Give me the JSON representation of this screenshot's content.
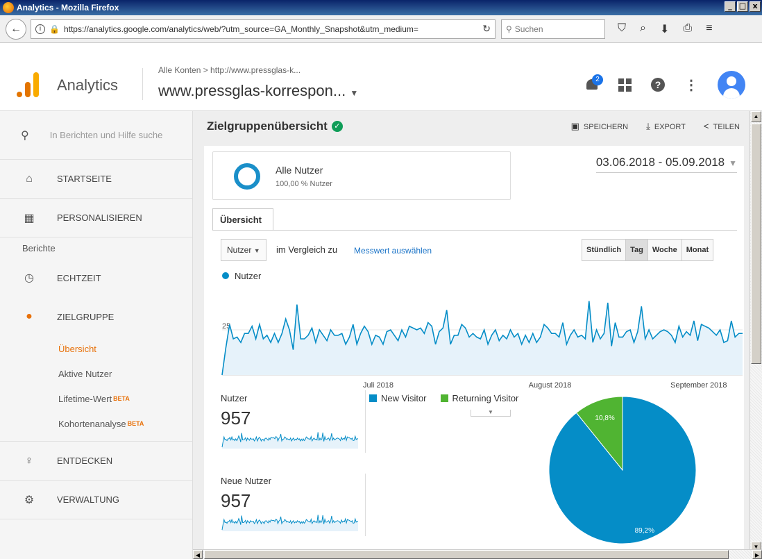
{
  "window": {
    "title": "Analytics - Mozilla Firefox",
    "buttons": [
      "_",
      "□",
      "x"
    ]
  },
  "browser": {
    "url": "https://analytics.google.com/analytics/web/?utm_source=GA_Monthly_Snapshot&utm_medium=",
    "search_placeholder": "Suchen"
  },
  "header": {
    "app_name": "Analytics",
    "breadcrumb": "Alle Konten > http://www.pressglas-k...",
    "property": "www.pressglas-korrespon...",
    "notification_count": "2",
    "accent_color": "#e37400"
  },
  "sidebar": {
    "search_placeholder": "In Berichten und Hilfe suche",
    "home": "STARTSEITE",
    "customize": "PERSONALISIEREN",
    "reports_heading": "Berichte",
    "realtime": "ECHTZEIT",
    "audience": "ZIELGRUPPE",
    "audience_sub": [
      {
        "label": "Übersicht",
        "beta": ""
      },
      {
        "label": "Aktive Nutzer",
        "beta": ""
      },
      {
        "label": "Lifetime-Wert",
        "beta": "BETA"
      },
      {
        "label": "Kohortenanalyse",
        "beta": "BETA"
      }
    ],
    "discover": "ENTDECKEN",
    "admin": "VERWALTUNG"
  },
  "main": {
    "title": "Zielgruppenübersicht",
    "actions": {
      "save": "SPEICHERN",
      "export": "EXPORT",
      "share": "TEILEN"
    },
    "segment": {
      "name": "Alle Nutzer",
      "pct": "100,00 % Nutzer"
    },
    "date_range": "03.06.2018 - 05.09.2018",
    "tab": "Übersicht",
    "metric_select": "Nutzer",
    "compare_text": "im Vergleich zu",
    "compare_link": "Messwert auswählen",
    "periods": [
      "Stündlich",
      "Tag",
      "Woche",
      "Monat"
    ],
    "active_period": "Tag",
    "series_label": "Nutzer"
  },
  "chart_data": [
    {
      "type": "area",
      "series": [
        {
          "name": "Nutzer",
          "values": [
            0,
            15,
            28,
            20,
            21,
            18,
            23,
            23,
            27,
            20,
            28,
            20,
            22,
            18,
            23,
            18,
            23,
            31,
            25,
            14,
            39,
            20,
            20,
            22,
            26,
            18,
            25,
            22,
            19,
            25,
            22,
            22,
            23,
            17,
            21,
            28,
            17,
            23,
            27,
            24,
            17,
            22,
            21,
            17,
            24,
            25,
            22,
            19,
            25,
            21,
            27,
            26,
            25,
            26,
            23,
            29,
            27,
            17,
            24,
            26,
            36,
            17,
            22,
            22,
            28,
            26,
            21,
            23,
            21,
            20,
            25,
            17,
            22,
            25,
            19,
            22,
            20,
            25,
            21,
            23,
            17,
            22,
            18,
            23,
            18,
            21,
            28,
            26,
            23,
            23,
            21,
            29,
            17,
            22,
            25,
            21,
            22,
            20,
            41,
            18,
            25,
            20,
            23,
            40,
            16,
            29,
            21,
            21,
            24,
            25,
            18,
            24,
            38,
            20,
            25,
            20,
            22,
            24,
            25,
            24,
            22,
            18,
            27,
            21,
            24,
            22,
            30,
            19,
            28,
            27,
            26,
            24,
            22,
            25,
            18,
            19,
            30,
            21,
            23,
            23
          ]
        }
      ],
      "x_tick_labels": [
        "Juli 2018",
        "August 2018",
        "September 2018"
      ],
      "y_tick_labels": [
        "25"
      ],
      "ylim": [
        0,
        50
      ],
      "color": "#058dc7"
    },
    {
      "type": "pie",
      "categories": [
        "New Visitor",
        "Returning Visitor"
      ],
      "values": [
        89.2,
        10.8
      ],
      "value_labels": [
        "89,2%",
        "10,8%"
      ],
      "colors": [
        "#058dc7",
        "#50b432"
      ]
    }
  ],
  "sparklines": [
    {
      "label": "Nutzer",
      "value": "957"
    },
    {
      "label": "Neue Nutzer",
      "value": "957"
    }
  ]
}
